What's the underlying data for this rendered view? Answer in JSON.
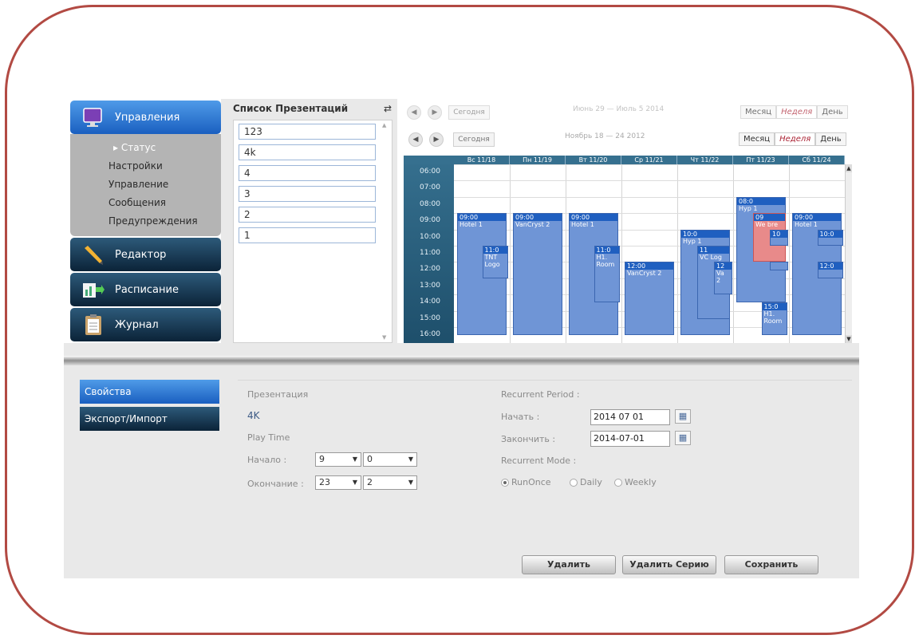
{
  "nav": {
    "items": [
      {
        "label": "Управления",
        "icon": "monitor-icon"
      },
      {
        "label": "Редактор",
        "icon": "pencil-icon"
      },
      {
        "label": "Расписание",
        "icon": "schedule-icon"
      },
      {
        "label": "Журнал",
        "icon": "clipboard-icon"
      }
    ],
    "submenu": [
      "▸ Статус",
      "Настройки",
      "Управление",
      "Сообщения",
      "Предупреждения"
    ]
  },
  "presentations": {
    "title": "Список Презентаций",
    "items": [
      "123",
      "4k",
      "4",
      "3",
      "2",
      "1"
    ]
  },
  "calendar": {
    "toolbar1": {
      "today": "Сегодня",
      "range": "Июнь 29 — Июль 5 2014",
      "views": [
        "Месяц",
        "Неделя",
        "День"
      ],
      "selected_view": "Неделя"
    },
    "toolbar2": {
      "today": "Сегодня",
      "range": "Ноябрь 18 — 24 2012",
      "views": [
        "Месяц",
        "Неделя",
        "День"
      ],
      "selected_view": "Неделя"
    },
    "days": [
      "Вс 11/18",
      "Пн 11/19",
      "Вт 11/20",
      "Ср 11/21",
      "Чт 11/22",
      "Пт 11/23",
      "Сб 11/24"
    ],
    "hours": [
      "06:00",
      "07:00",
      "08:00",
      "09:00",
      "10:00",
      "11:00",
      "12:00",
      "13:00",
      "14:00",
      "15:00",
      "16:00"
    ],
    "events": [
      {
        "day": 0,
        "start": 9,
        "end": 16.5,
        "time": "09:00",
        "name": "Hotel 1",
        "color": "blue"
      },
      {
        "day": 0,
        "start": 11,
        "end": 13,
        "time": "11:0",
        "name": "TNT Logo",
        "color": "blue",
        "offset": 0.45
      },
      {
        "day": 1,
        "start": 9,
        "end": 16.5,
        "time": "09:00",
        "name": "VanCryst 2",
        "color": "blue"
      },
      {
        "day": 2,
        "start": 9,
        "end": 16.5,
        "time": "09:00",
        "name": "Hotel 1",
        "color": "blue"
      },
      {
        "day": 2,
        "start": 11,
        "end": 14.5,
        "time": "11:0",
        "name": "H1. Room",
        "color": "blue",
        "offset": 0.45
      },
      {
        "day": 3,
        "start": 12,
        "end": 16.5,
        "time": "12:00",
        "name": "VanCryst 2",
        "color": "blue"
      },
      {
        "day": 4,
        "start": 10,
        "end": 16.5,
        "time": "10:0",
        "name": "Hyp 1",
        "color": "blue"
      },
      {
        "day": 4,
        "start": 11,
        "end": 15.5,
        "time": "11",
        "name": "VC Log",
        "color": "blue",
        "offset": 0.3
      },
      {
        "day": 4,
        "start": 12,
        "end": 14,
        "time": "12",
        "name": "Va 2",
        "color": "blue",
        "offset": 0.6
      },
      {
        "day": 5,
        "start": 8,
        "end": 14.5,
        "time": "08:0",
        "name": "Hyp 1",
        "color": "blue"
      },
      {
        "day": 5,
        "start": 9,
        "end": 12,
        "time": "09",
        "name": "We bre",
        "color": "pink",
        "offset": 0.3
      },
      {
        "day": 5,
        "start": 10,
        "end": 11,
        "time": "10",
        "name": "",
        "color": "blue",
        "offset": 0.6
      },
      {
        "day": 5,
        "start": 12,
        "end": 12.5,
        "time": "",
        "name": "",
        "color": "blue",
        "offset": 0.6
      },
      {
        "day": 5,
        "start": 14.5,
        "end": 16.5,
        "time": "15:0",
        "name": "H1. Room",
        "color": "blue",
        "offset": 0.45
      },
      {
        "day": 6,
        "start": 9,
        "end": 16.5,
        "time": "09:00",
        "name": "Hotel 1",
        "color": "blue"
      },
      {
        "day": 6,
        "start": 10,
        "end": 11,
        "time": "10:0",
        "name": "",
        "color": "blue",
        "offset": 0.45
      },
      {
        "day": 6,
        "start": 12,
        "end": 13,
        "time": "12:0",
        "name": "",
        "color": "blue",
        "offset": 0.45
      }
    ]
  },
  "tabs": [
    "Свойства",
    "Экспорт/Импорт"
  ],
  "props": {
    "presentation_label": "Презентация",
    "presentation_value": "4K",
    "play_time_label": "Play Time",
    "start_label": "Начало :",
    "start_hour": "9",
    "start_min": "0",
    "end_label": "Окончание :",
    "end_hour": "23",
    "end_min": "2"
  },
  "recurrence": {
    "period_label": "Recurrent Period :",
    "start_label": "Начать :",
    "start_value": "2014 07 01",
    "end_label": "Закончить :",
    "end_value": "2014-07-01",
    "mode_label": "Recurrent Mode :",
    "modes": [
      "RunOnce",
      "Daily",
      "Weekly"
    ],
    "selected_mode": "RunOnce"
  },
  "actions": {
    "delete": "Удалить",
    "delete_series": "Удалить Серию",
    "save": "Сохранить"
  }
}
